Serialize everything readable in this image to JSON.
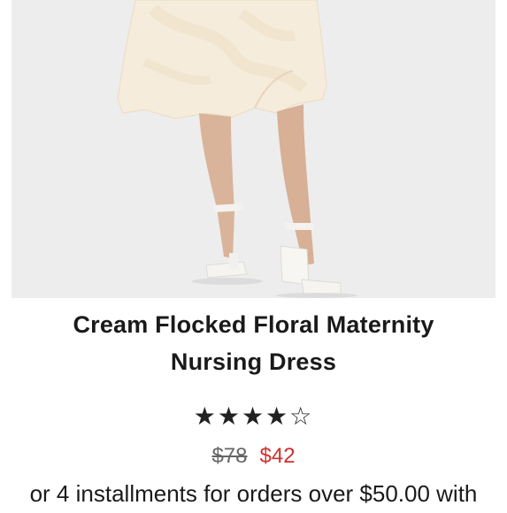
{
  "product": {
    "image_alt": "Cream dress with white block heel sandals",
    "title_line1": "Cream Flocked Floral Maternity",
    "title_line2": "Nursing Dress",
    "rating": {
      "filled": 4,
      "total": 5
    },
    "price_original": "$78",
    "price_sale": "$42",
    "installments_text": "or 4 installments for orders over $50.00 with"
  },
  "colors": {
    "sale_price": "#d0302f",
    "dress": "#f5ebd8",
    "background": "#ececec"
  },
  "icons": {
    "star_filled": "★",
    "star_empty": "☆"
  }
}
